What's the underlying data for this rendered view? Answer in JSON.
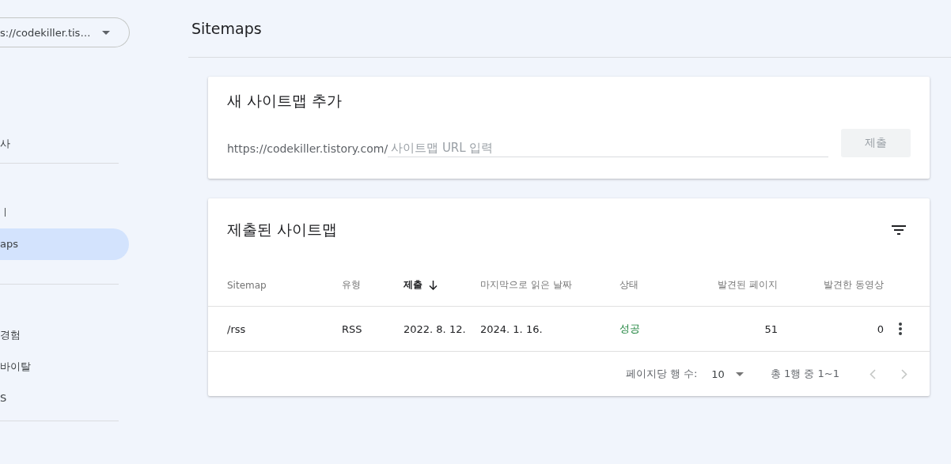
{
  "property_selector": {
    "value": "s://codekiller.tis…"
  },
  "sidebar": {
    "sections": [
      {
        "items": [
          {
            "label": "사",
            "selected": false
          }
        ]
      },
      {
        "items": [
          {
            "label": "ㅣ",
            "selected": false
          },
          {
            "label": "aps",
            "selected": true
          }
        ]
      },
      {
        "items": [
          {
            "label": "경험",
            "selected": false
          },
          {
            "label": "바이탈",
            "selected": false
          },
          {
            "label": "S",
            "selected": false
          }
        ]
      }
    ]
  },
  "page": {
    "title": "Sitemaps"
  },
  "add_card": {
    "title": "새 사이트맵 추가",
    "prefix": "https://codekiller.tistory.com/",
    "placeholder": "사이트맵 URL 입력",
    "submit": {
      "label": "제출",
      "disabled": true
    }
  },
  "submitted_card": {
    "title": "제출된 사이트맵",
    "table": {
      "columns": [
        {
          "label": "Sitemap",
          "sorted": false
        },
        {
          "label": "유형",
          "sorted": false
        },
        {
          "label": "제출",
          "sorted": true
        },
        {
          "label": "마지막으로 읽은 날짜",
          "sorted": false
        },
        {
          "label": "상태",
          "sorted": false
        },
        {
          "label": "발견된 페이지",
          "sorted": false
        },
        {
          "label": "발견한 동영상",
          "sorted": false
        }
      ],
      "rows": [
        {
          "cells": [
            "/rss",
            "RSS",
            "2022. 8. 12.",
            "2024. 1. 16.",
            "성공",
            "51",
            "0"
          ],
          "success": true
        }
      ]
    },
    "pagination": {
      "rows_label": "페이지당 행 수:",
      "rows_value": "10",
      "range": "총 1행 중 1~1",
      "prev_disabled": true,
      "next_disabled": true
    }
  }
}
